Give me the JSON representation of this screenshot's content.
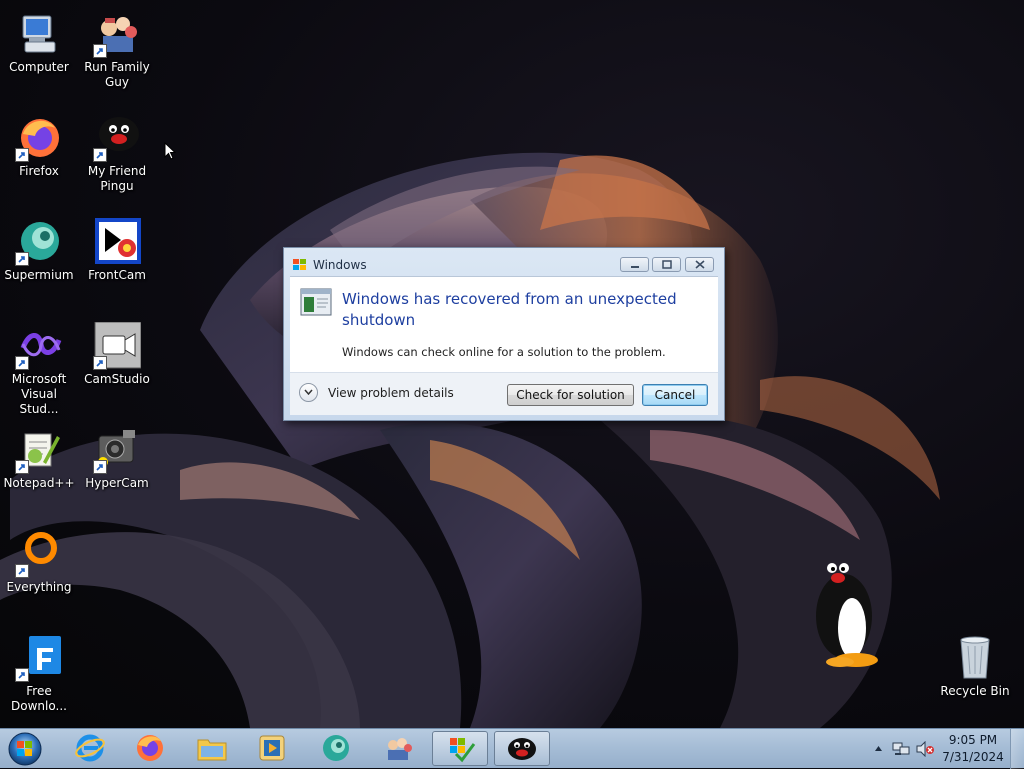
{
  "desktop": {
    "icons": [
      {
        "label": "Computer",
        "icon": "computer-icon"
      },
      {
        "label": "Run Family Guy",
        "icon": "family-guy-icon"
      },
      {
        "label": "Firefox",
        "icon": "firefox-icon"
      },
      {
        "label": "My Friend Pingu",
        "icon": "pingu-icon"
      },
      {
        "label": "Supermium",
        "icon": "supermium-icon"
      },
      {
        "label": "FrontCam",
        "icon": "frontcam-icon"
      },
      {
        "label": "Microsoft Visual Stud...",
        "icon": "visual-studio-icon"
      },
      {
        "label": "CamStudio",
        "icon": "camstudio-icon"
      },
      {
        "label": "Notepad++",
        "icon": "notepad-plus-plus-icon"
      },
      {
        "label": "HyperCam",
        "icon": "hypercam-icon"
      },
      {
        "label": "Everything",
        "icon": "everything-icon"
      },
      {
        "label": "Free Downlo...",
        "icon": "free-download-manager-icon"
      },
      {
        "label": "Recycle Bin",
        "icon": "recycle-bin-icon"
      }
    ]
  },
  "dialog": {
    "title": "Windows",
    "headline": "Windows has recovered from an unexpected shutdown",
    "subtext": "Windows can check online for a solution to the problem.",
    "details_label": "View problem details",
    "check_button": "Check for solution",
    "cancel_button": "Cancel"
  },
  "taskbar": {
    "pinned": [
      {
        "icon": "internet-explorer-icon"
      },
      {
        "icon": "firefox-icon"
      },
      {
        "icon": "file-explorer-icon"
      },
      {
        "icon": "media-player-icon"
      },
      {
        "icon": "supermium-icon"
      },
      {
        "icon": "family-guy-icon"
      },
      {
        "icon": "windows-error-dialog-icon",
        "active": true
      },
      {
        "icon": "pingu-icon",
        "active": true
      }
    ],
    "clock_time": "9:05 PM",
    "clock_date": "7/31/2024"
  },
  "colors": {
    "taskbar": "#a6bdd6",
    "dialog_headline": "#1e3fa0",
    "wallpaper_glow": "#c8744a"
  }
}
